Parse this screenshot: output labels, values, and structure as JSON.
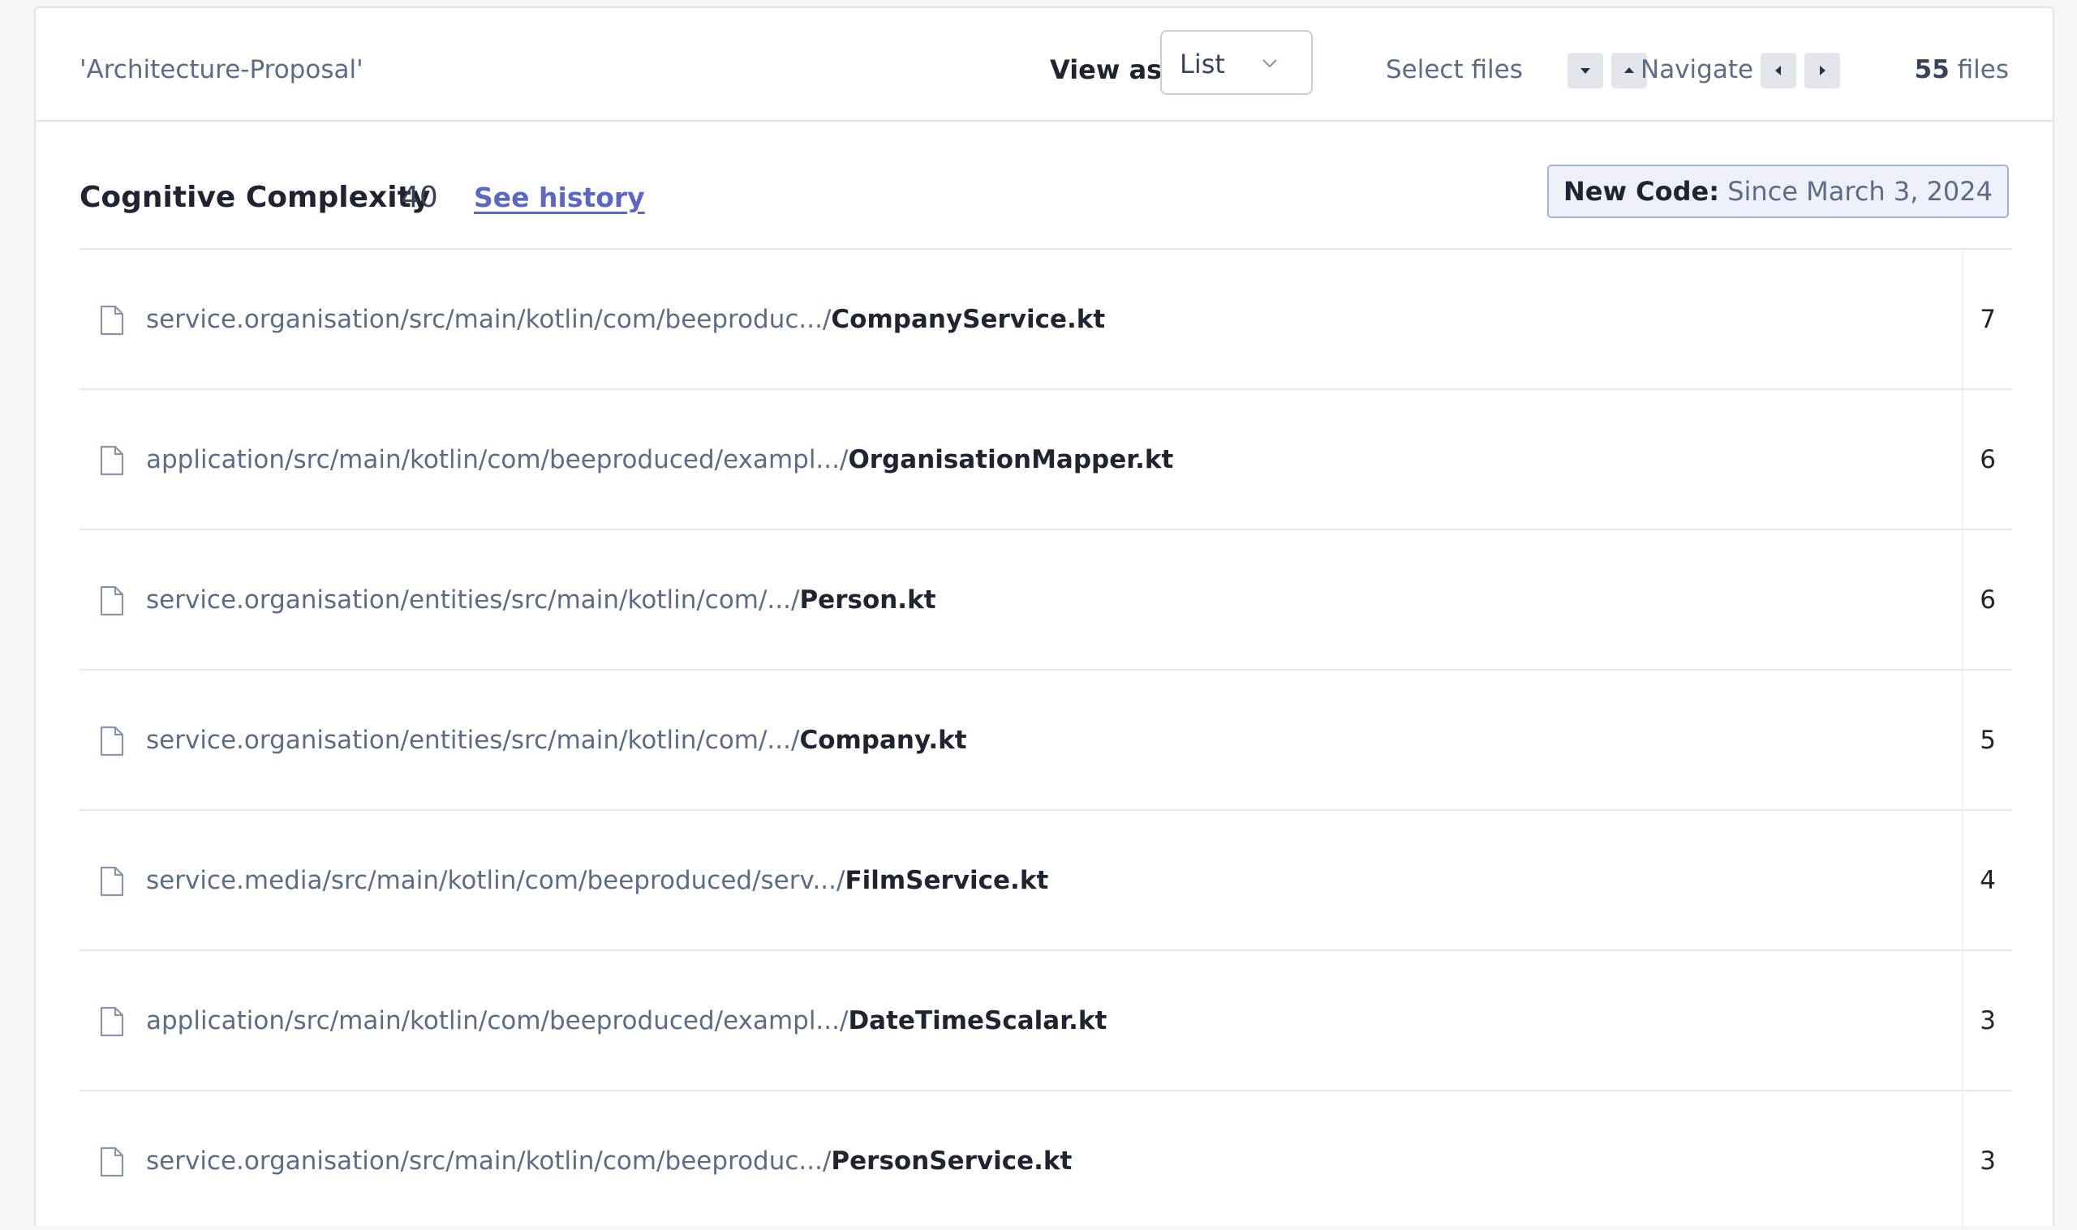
{
  "header": {
    "breadcrumb": "'Architecture-Proposal'",
    "view_as_label": "View as",
    "view_as_value": "List",
    "select_files_label": "Select files",
    "navigate_label": "Navigate",
    "file_count_number": "55",
    "file_count_suffix": " files"
  },
  "metric": {
    "name": "Cognitive Complexity",
    "value": "40",
    "history_link": "See history",
    "new_code_label": "New Code:",
    "new_code_value": " Since March 3, 2024"
  },
  "icons": {
    "file": "file-icon",
    "chevron": "chevron-down-icon",
    "down": "caret-down-icon",
    "up": "caret-up-icon",
    "left": "caret-left-icon",
    "right": "caret-right-icon"
  },
  "files": [
    {
      "dir": "service.organisation/src/main/kotlin/com/beeproduc.../",
      "name": "CompanyService.kt",
      "value": "7"
    },
    {
      "dir": "application/src/main/kotlin/com/beeproduced/exampl.../",
      "name": "OrganisationMapper.kt",
      "value": "6"
    },
    {
      "dir": "service.organisation/entities/src/main/kotlin/com/.../",
      "name": "Person.kt",
      "value": "6"
    },
    {
      "dir": "service.organisation/entities/src/main/kotlin/com/.../",
      "name": "Company.kt",
      "value": "5"
    },
    {
      "dir": "service.media/src/main/kotlin/com/beeproduced/serv.../",
      "name": "FilmService.kt",
      "value": "4"
    },
    {
      "dir": "application/src/main/kotlin/com/beeproduced/exampl.../",
      "name": "DateTimeScalar.kt",
      "value": "3"
    },
    {
      "dir": "service.organisation/src/main/kotlin/com/beeproduc.../",
      "name": "PersonService.kt",
      "value": "3"
    }
  ]
}
